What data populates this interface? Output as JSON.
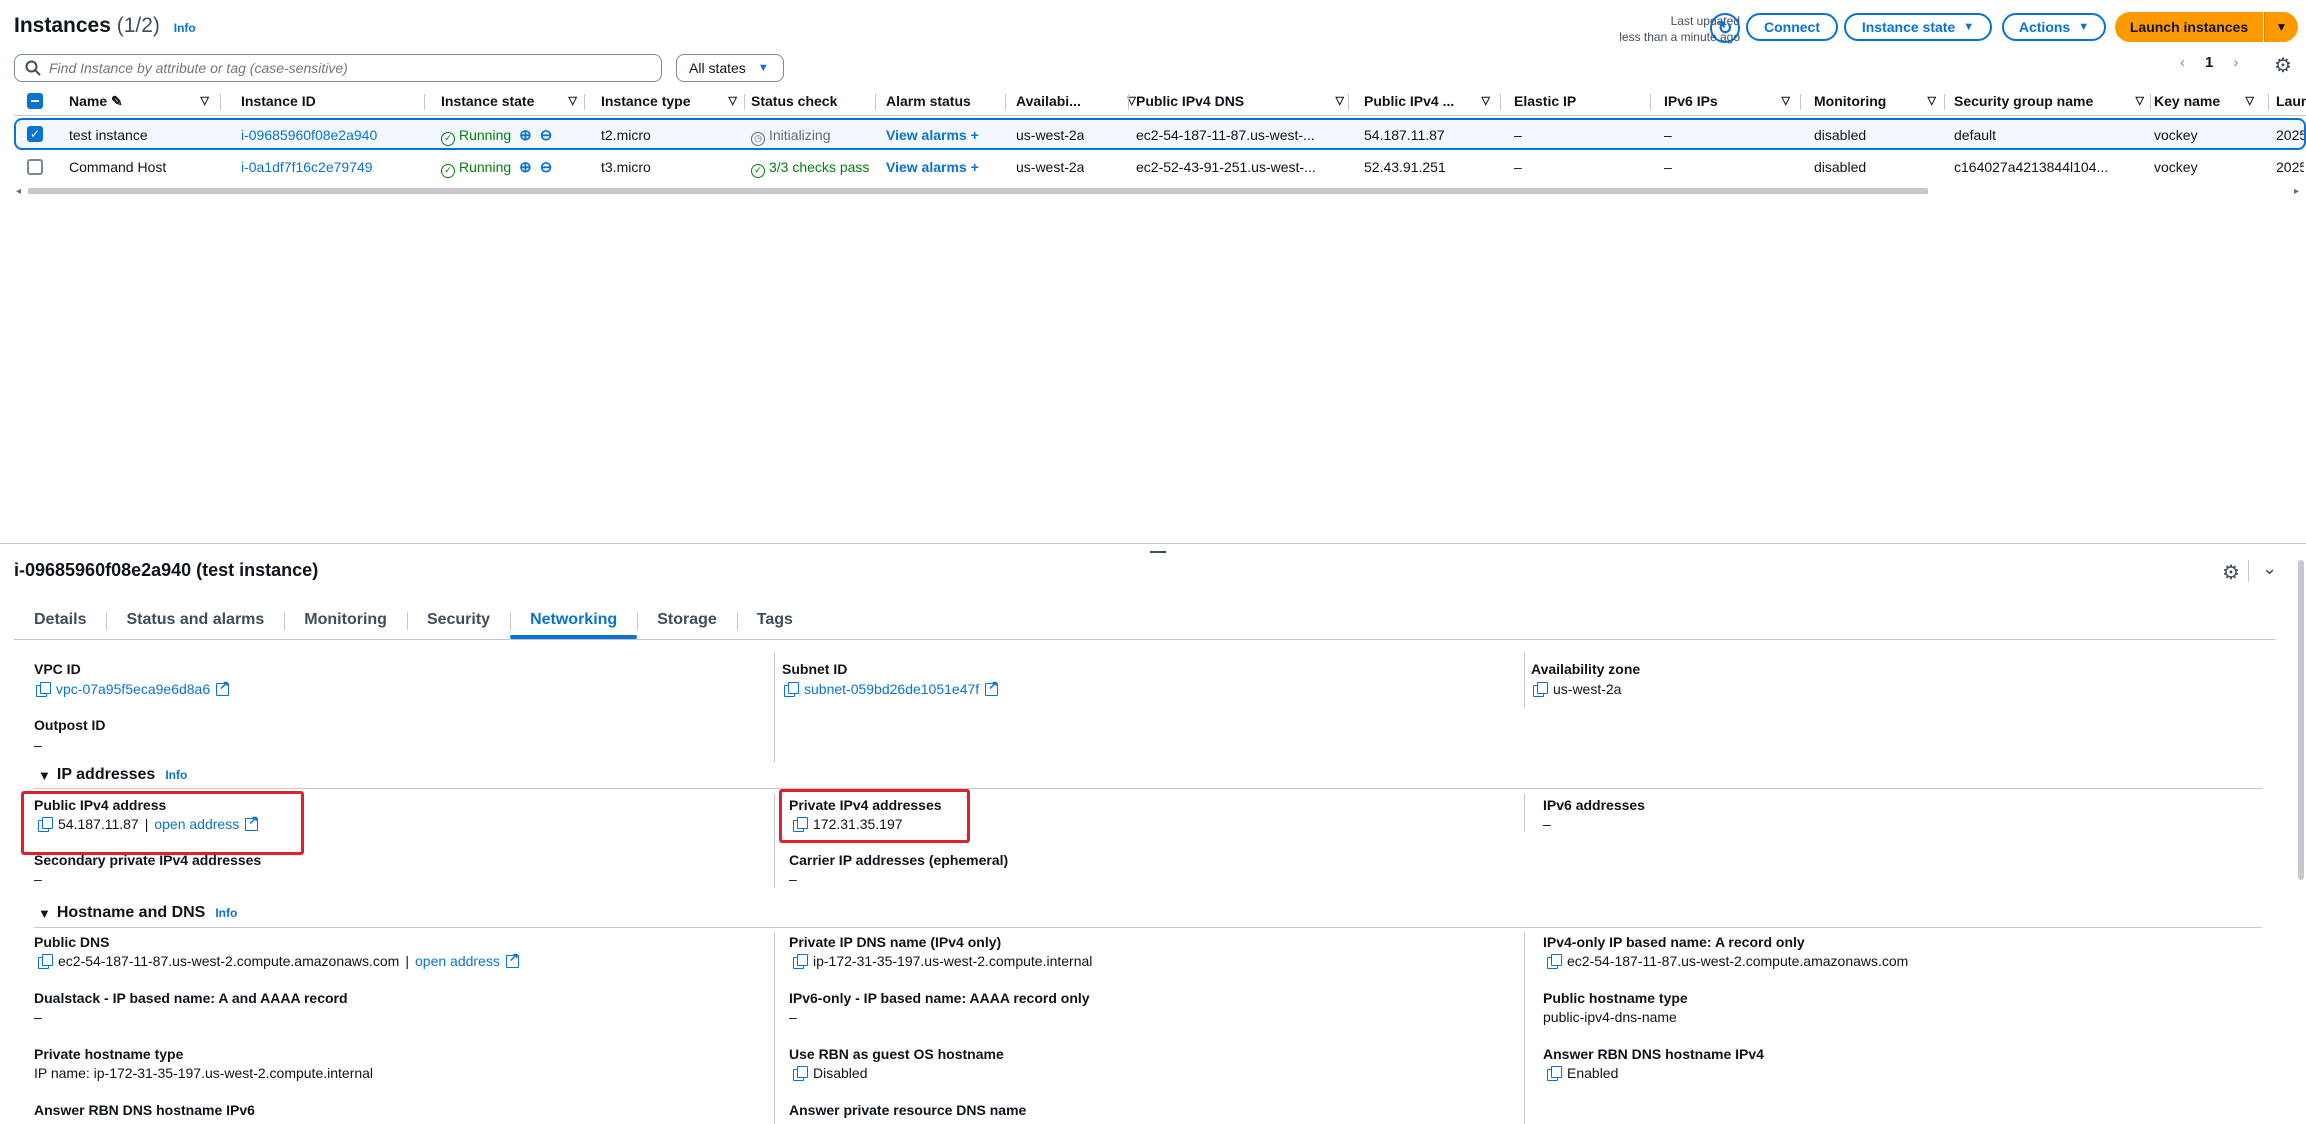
{
  "header": {
    "title": "Instances",
    "count": "(1/2)",
    "info": "Info",
    "last_updated_1": "Last updated",
    "last_updated_2": "less than a minute ago",
    "connect": "Connect",
    "instance_state": "Instance state",
    "actions": "Actions",
    "launch": "Launch instances"
  },
  "filter": {
    "placeholder": "Find Instance by attribute or tag (case-sensitive)",
    "states": "All states",
    "page": "1"
  },
  "table": {
    "columns": [
      "Name",
      "Instance ID",
      "Instance state",
      "Instance type",
      "Status check",
      "Alarm status",
      "Availabi...",
      "Public IPv4 DNS",
      "Public IPv4 ...",
      "Elastic IP",
      "IPv6 IPs",
      "Monitoring",
      "Security group name",
      "Key name",
      "Laun"
    ],
    "rows": [
      {
        "name": "test instance",
        "id": "i-09685960f08e2a940",
        "state": "Running",
        "type": "t2.micro",
        "status": "Initializing",
        "alarm": "View alarms",
        "az": "us-west-2a",
        "dns": "ec2-54-187-11-87.us-west-...",
        "ipv4": "54.187.11.87",
        "eip": "–",
        "ipv6": "–",
        "monitoring": "disabled",
        "sg": "default",
        "key": "vockey",
        "launch": "2025"
      },
      {
        "name": "Command Host",
        "id": "i-0a1df7f16c2e79749",
        "state": "Running",
        "type": "t3.micro",
        "status": "3/3 checks pass",
        "alarm": "View alarms",
        "az": "us-west-2a",
        "dns": "ec2-52-43-91-251.us-west-...",
        "ipv4": "52.43.91.251",
        "eip": "–",
        "ipv6": "–",
        "monitoring": "disabled",
        "sg": "c164027a4213844l104...",
        "key": "vockey",
        "launch": "2025"
      }
    ]
  },
  "detail": {
    "title": "i-09685960f08e2a940 (test instance)",
    "tabs": [
      "Details",
      "Status and alarms",
      "Monitoring",
      "Security",
      "Networking",
      "Storage",
      "Tags"
    ],
    "vpc_label": "VPC ID",
    "vpc_value": "vpc-07a95f5eca9e6d8a6",
    "subnet_label": "Subnet ID",
    "subnet_value": "subnet-059bd26de1051e47f",
    "az_label": "Availability zone",
    "az_value": "us-west-2a",
    "outpost_label": "Outpost ID",
    "outpost_value": "–",
    "ip_section": "IP addresses",
    "info": "Info",
    "public_ipv4_label": "Public IPv4 address",
    "public_ipv4_value": "54.187.11.87",
    "sep": "|",
    "open_address": "open address",
    "private_ipv4_label": "Private IPv4 addresses",
    "private_ipv4_value": "172.31.35.197",
    "ipv6_label": "IPv6 addresses",
    "ipv6_value": "–",
    "secondary_label": "Secondary private IPv4 addresses",
    "secondary_value": "–",
    "carrier_label": "Carrier IP addresses (ephemeral)",
    "carrier_value": "–",
    "dns_section": "Hostname and DNS",
    "public_dns_label": "Public DNS",
    "public_dns_value": "ec2-54-187-11-87.us-west-2.compute.amazonaws.com",
    "private_ip_dns_label": "Private IP DNS name (IPv4 only)",
    "private_ip_dns_value": "ip-172-31-35-197.us-west-2.compute.internal",
    "ipv4_only_label": "IPv4-only IP based name: A record only",
    "ipv4_only_value": "ec2-54-187-11-87.us-west-2.compute.amazonaws.com",
    "dualstack_label": "Dualstack - IP based name: A and AAAA record",
    "dualstack_value": "–",
    "ipv6_only_label": "IPv6-only - IP based name: AAAA record only",
    "ipv6_only_value": "–",
    "public_hostname_type_label": "Public hostname type",
    "public_hostname_type_value": "public-ipv4-dns-name",
    "private_hostname_type_label": "Private hostname type",
    "private_hostname_type_value": "IP name: ip-172-31-35-197.us-west-2.compute.internal",
    "use_rbn_label": "Use RBN as guest OS hostname",
    "use_rbn_value": "Disabled",
    "answer_rbn_ipv4_label": "Answer RBN DNS hostname IPv4",
    "answer_rbn_ipv4_value": "Enabled",
    "answer_rbn_ipv6_label": "Answer RBN DNS hostname IPv6",
    "answer_private_label": "Answer private resource DNS name"
  }
}
